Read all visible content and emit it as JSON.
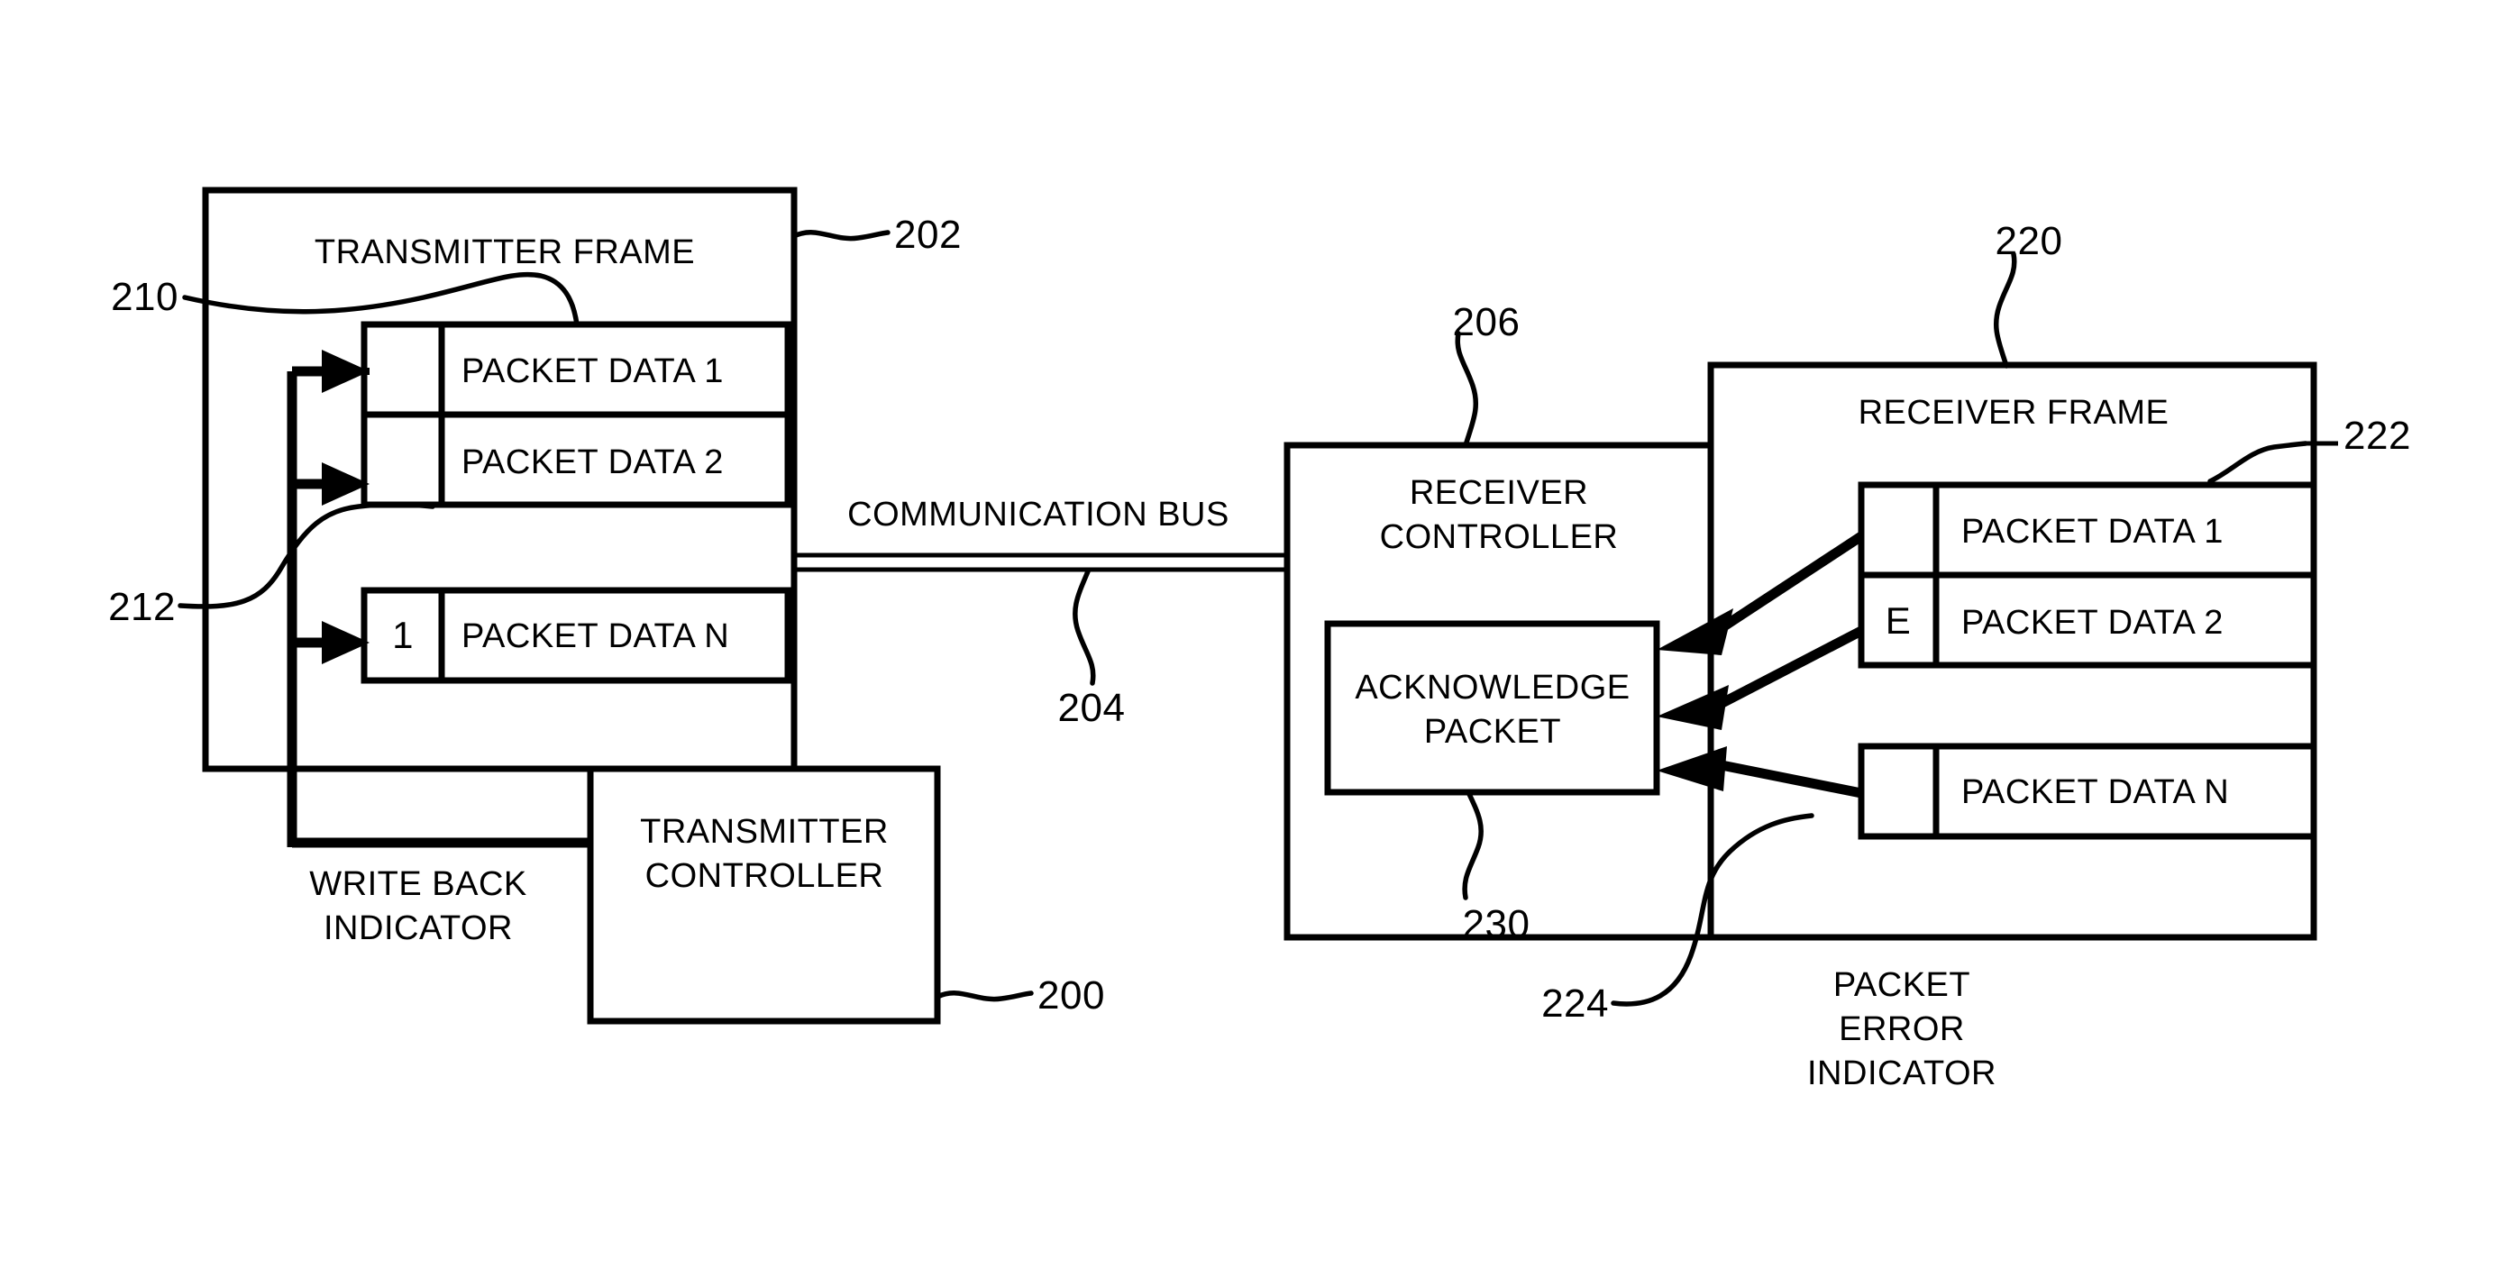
{
  "figure": {
    "title": "Transmitter and receiver frame packet acknowledgement block diagram",
    "stroke_color": "#000000",
    "background_color": "#ffffff"
  },
  "transmitter": {
    "frame_label": "TRANSMITTER FRAME",
    "frame_ref": "202",
    "frame_ref_callout": "210",
    "write_back_ref": "212",
    "controller_label_line1": "TRANSMITTER",
    "controller_label_line2": "CONTROLLER",
    "controller_ref": "200",
    "write_back_label_line1": "WRITE BACK",
    "write_back_label_line2": "INDICATOR",
    "rows": [
      {
        "flag": "",
        "label": "PACKET DATA 1"
      },
      {
        "flag": "",
        "label": "PACKET DATA 2"
      },
      {
        "flag": "1",
        "label": "PACKET DATA N"
      }
    ]
  },
  "bus": {
    "label": "COMMUNICATION BUS",
    "ref": "204"
  },
  "receiver_controller": {
    "label_line1": "RECEIVER",
    "label_line2": "CONTROLLER",
    "ref": "206",
    "acknowledge_label_line1": "ACKNOWLEDGE",
    "acknowledge_label_line2": "PACKET",
    "acknowledge_ref": "230"
  },
  "receiver": {
    "frame_label": "RECEIVER FRAME",
    "frame_ref": "220",
    "rows_ref": "222",
    "error_ref": "224",
    "error_label_line1": "PACKET",
    "error_label_line2": "ERROR",
    "error_label_line3": "INDICATOR",
    "rows": [
      {
        "flag": "",
        "label": "PACKET DATA 1"
      },
      {
        "flag": "E",
        "label": "PACKET DATA 2"
      },
      {
        "flag": "",
        "label": "PACKET DATA N"
      }
    ]
  }
}
